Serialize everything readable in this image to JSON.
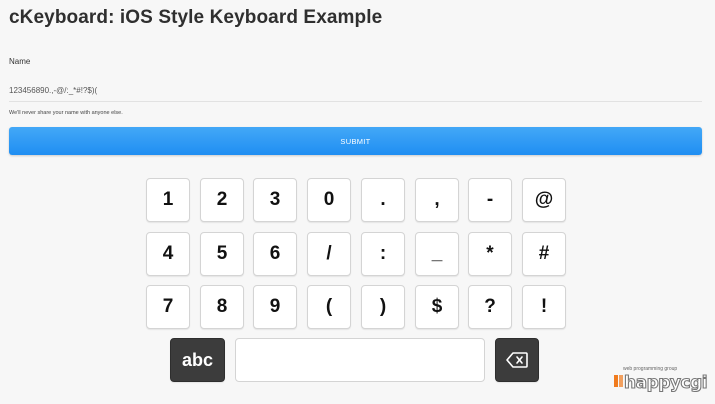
{
  "page": {
    "title": "cKeyboard: iOS Style Keyboard Example"
  },
  "form": {
    "name_label": "Name",
    "name_value": "123456890.,-@/:_*#!?$)(",
    "help_text": "We'll never share your name with anyone else.",
    "submit_label": "SUBMIT"
  },
  "keyboard": {
    "rows": [
      [
        "1",
        "2",
        "3",
        "0",
        ".",
        ",",
        "-",
        "@"
      ],
      [
        "4",
        "5",
        "6",
        "/",
        ":",
        "_",
        "*",
        "#"
      ],
      [
        "7",
        "8",
        "9",
        "(",
        ")",
        "$",
        "?",
        "!"
      ]
    ],
    "abc_label": "abc",
    "backspace_icon": "backspace-icon"
  },
  "logo": {
    "tagline": "web programming group",
    "wordmark": "happycgi"
  },
  "colors": {
    "submit": "#2196f3",
    "dark_key": "#3c3c3c",
    "logo_orange": "#f07b1e"
  }
}
